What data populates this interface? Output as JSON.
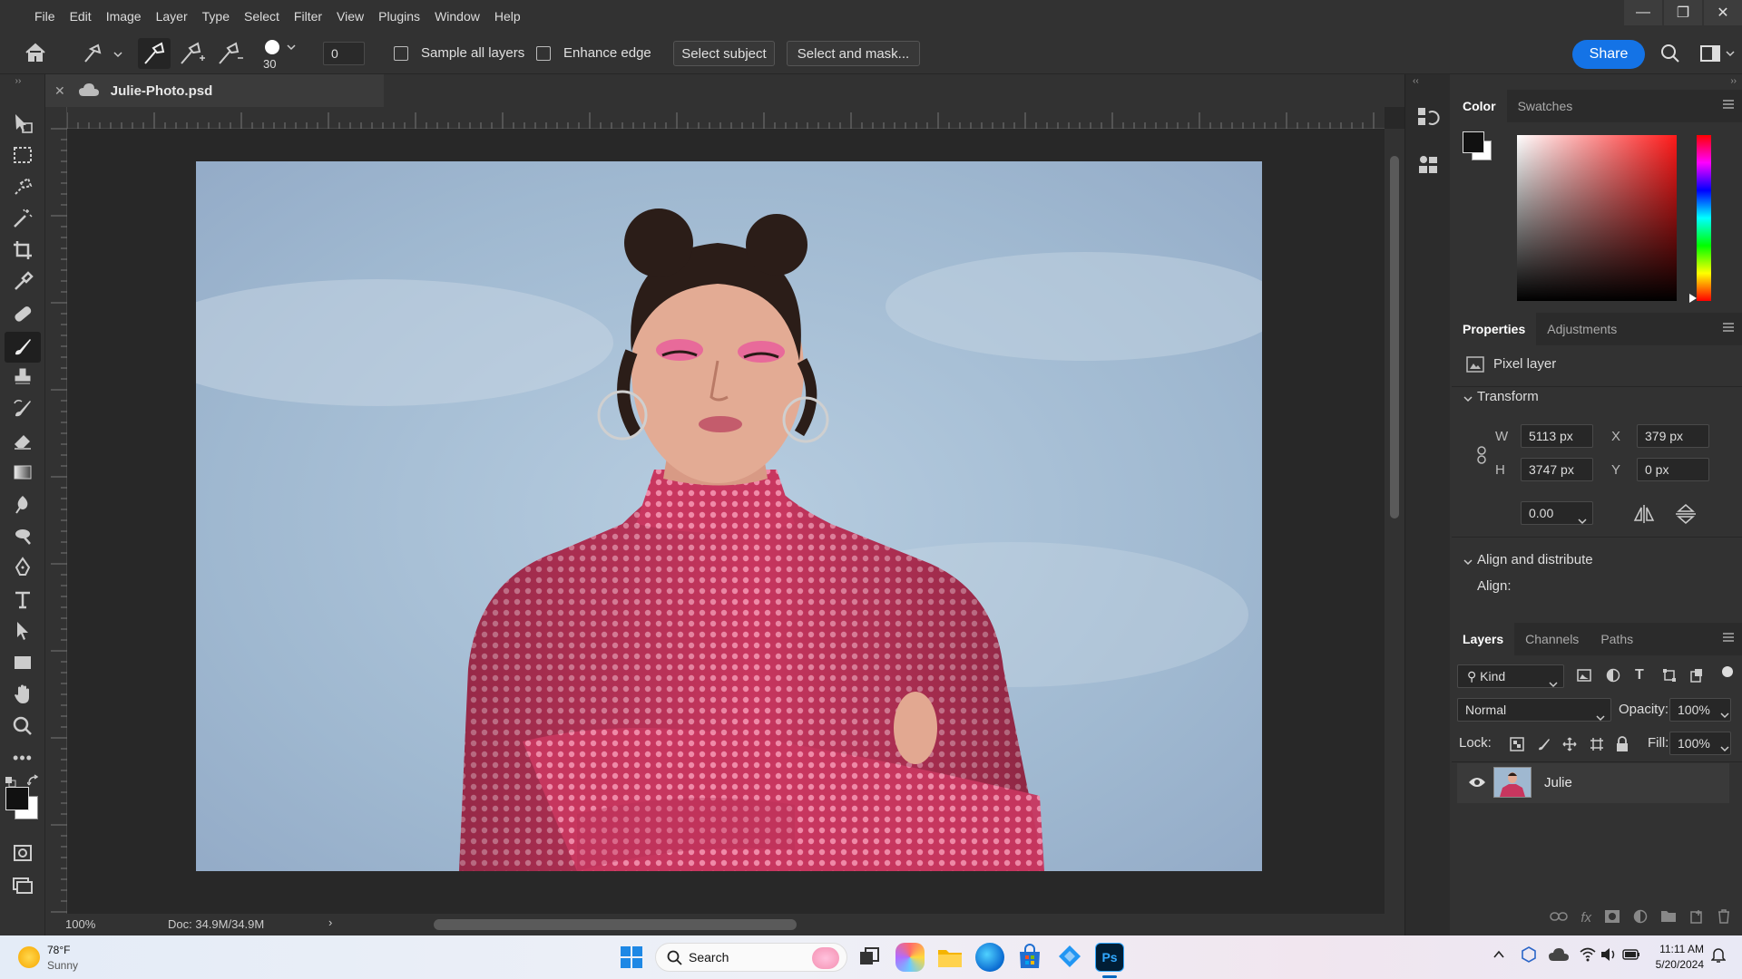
{
  "menu": [
    "File",
    "Edit",
    "Image",
    "Layer",
    "Type",
    "Select",
    "Filter",
    "View",
    "Plugins",
    "Window",
    "Help"
  ],
  "options": {
    "brush_size": "30",
    "value": "0",
    "sample_all_layers": "Sample all layers",
    "enhance_edge": "Enhance edge",
    "select_subject": "Select subject",
    "select_and_mask": "Select and mask...",
    "share": "Share"
  },
  "document": {
    "tab_title": "Julie-Photo.psd",
    "zoom": "100%",
    "doc_size": "Doc: 34.9M/34.9M"
  },
  "color_panel": {
    "tabs": [
      "Color",
      "Swatches"
    ]
  },
  "properties": {
    "tabs": [
      "Properties",
      "Adjustments"
    ],
    "layer_type": "Pixel layer",
    "transform_label": "Transform",
    "w_label": "W",
    "w": "5113 px",
    "h_label": "H",
    "h": "3747 px",
    "x_label": "X",
    "x": "379 px",
    "y_label": "Y",
    "y": "0 px",
    "angle": "0.00",
    "align_distribute": "Align and distribute",
    "align": "Align:"
  },
  "layers": {
    "tabs": [
      "Layers",
      "Channels",
      "Paths"
    ],
    "kind": "Kind",
    "blend_mode": "Normal",
    "opacity_label": "Opacity:",
    "opacity": "100%",
    "lock_label": "Lock:",
    "fill_label": "Fill:",
    "fill": "100%",
    "items": [
      {
        "name": "Julie"
      }
    ]
  },
  "taskbar": {
    "temp": "78°F",
    "weather": "Sunny",
    "search": "Search",
    "time": "11:11 AM",
    "date": "5/20/2024"
  },
  "colors": {
    "accent": "#1473e6",
    "shirt": "#d3416b",
    "sky": "#9fb8d0"
  }
}
